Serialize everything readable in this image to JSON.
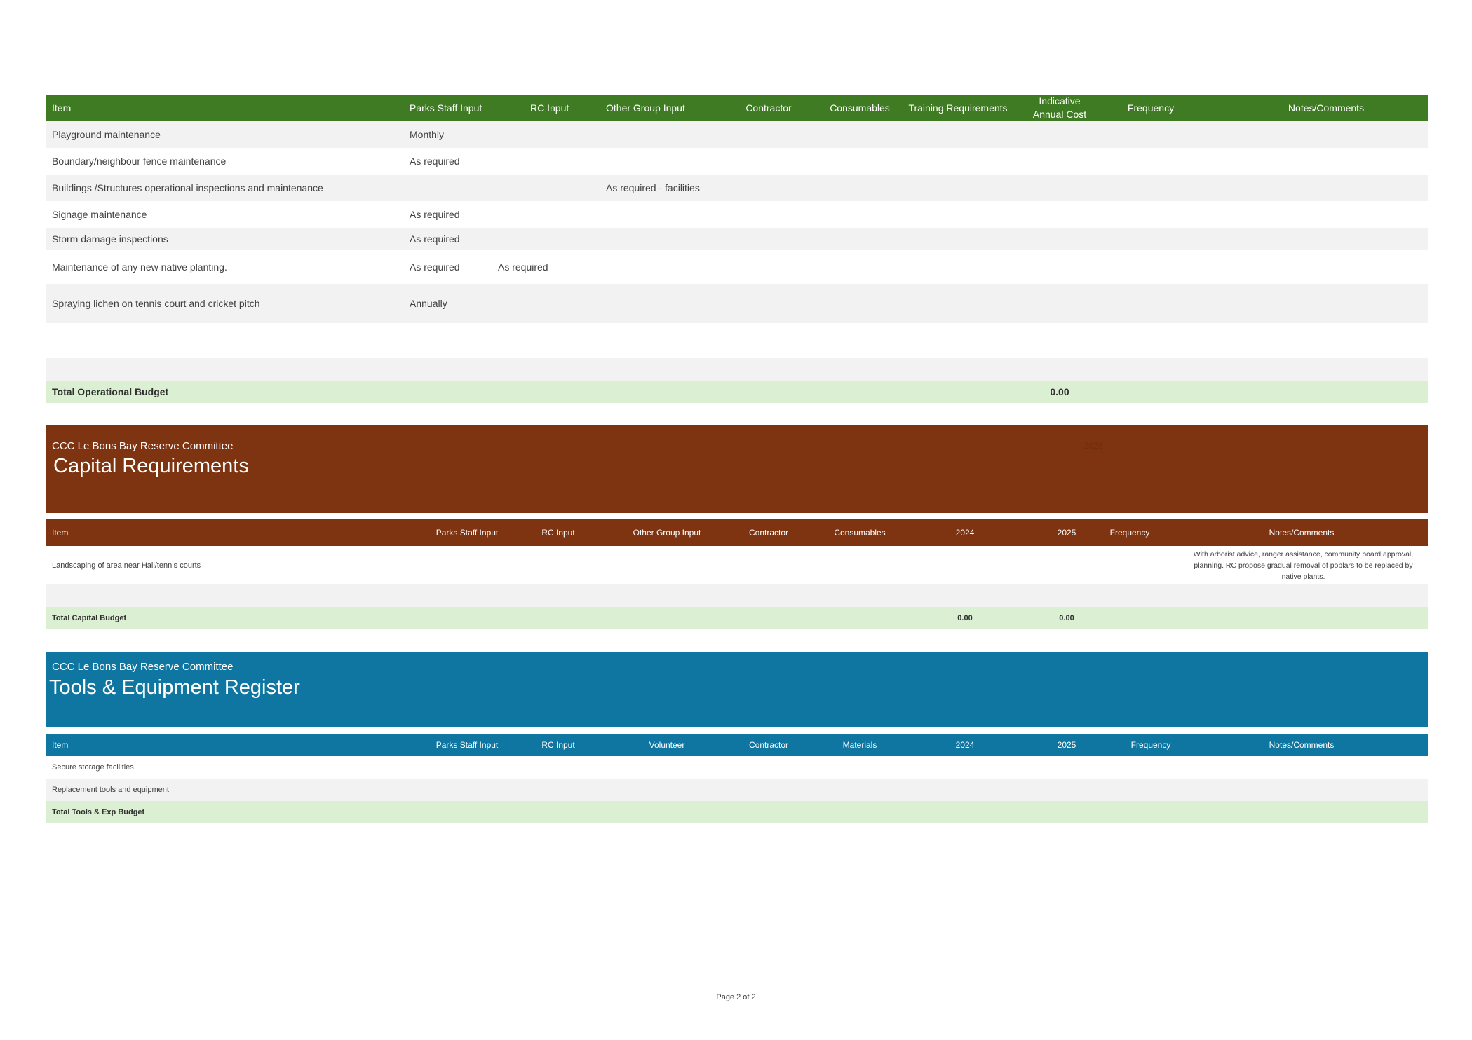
{
  "operational": {
    "headers": [
      "Item",
      "Parks Staff Input",
      "RC Input",
      "Other Group Input",
      "Contractor",
      "Consumables",
      "Training Requirements",
      "Indicative Annual Cost",
      "Frequency",
      "Notes/Comments"
    ],
    "rows": [
      {
        "item": "Playground maintenance",
        "parks": "Monthly",
        "rc": "",
        "other": ""
      },
      {
        "item": "Boundary/neighbour fence maintenance",
        "parks": "As required",
        "rc": "",
        "other": ""
      },
      {
        "item": "Buildings /Structures operational inspections and maintenance",
        "parks": "",
        "rc": "",
        "other": "As required - facilities"
      },
      {
        "item": "Signage maintenance",
        "parks": "As required",
        "rc": "",
        "other": ""
      },
      {
        "item": "Storm damage inspections",
        "parks": "As required",
        "rc": "",
        "other": ""
      },
      {
        "item": "Maintenance of any new native planting.",
        "parks": "As required",
        "rc": "As required",
        "other": ""
      },
      {
        "item": "Spraying lichen on tennis court and cricket pitch",
        "parks": "Annually",
        "rc": "",
        "other": ""
      }
    ],
    "total_label": "Total Operational Budget",
    "total_value": "0.00"
  },
  "capital": {
    "committee": "CCC Le Bons Bay Reserve Committee",
    "title": "Capital Requirements",
    "faint_year": "2023",
    "headers": [
      "Item",
      "Parks Staff Input",
      "RC Input",
      "Other Group Input",
      "Contractor",
      "Consumables",
      "2024",
      "2025",
      "Frequency",
      "Notes/Comments"
    ],
    "rows": [
      {
        "item": "Landscaping of area near Hall/tennis courts",
        "notes": "With arborist advice, ranger assistance, community board approval, planning. RC propose gradual removal of poplars to be replaced by native plants."
      }
    ],
    "total_label": "Total Capital Budget",
    "total_2024": "0.00",
    "total_2025": "0.00"
  },
  "tools": {
    "committee": "CCC Le Bons Bay Reserve Committee",
    "title": "Tools & Equipment Register",
    "headers": [
      "Item",
      "Parks Staff Input",
      "RC Input",
      "Volunteer",
      "Contractor",
      "Materials",
      "2024",
      "2025",
      "Frequency",
      "Notes/Comments"
    ],
    "rows": [
      {
        "item": "Secure storage facilities"
      },
      {
        "item": "Replacement tools and equipment"
      }
    ],
    "total_label": "Total Tools & Exp Budget"
  },
  "footer": "Page 2 of 2",
  "colors": {
    "operational_header": "#3e7b22",
    "capital_header": "#7e3311",
    "tools_header": "#0e76a0",
    "total_row": "#dbf0d2",
    "alt_row": "#f2f2f2"
  }
}
